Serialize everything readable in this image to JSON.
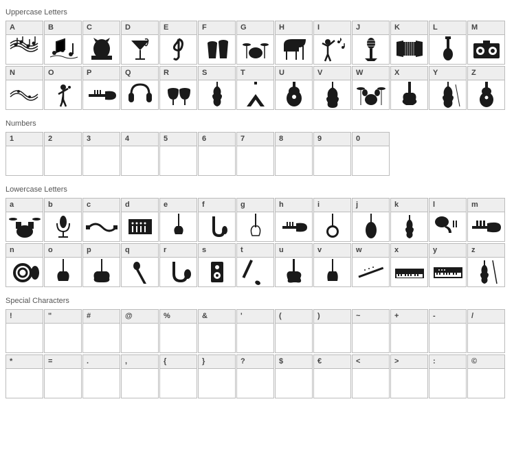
{
  "sections": {
    "uppercase": {
      "title": "Uppercase Letters",
      "cells": [
        {
          "label": "A",
          "glyph": "music-staff-notes",
          "empty": false
        },
        {
          "label": "B",
          "glyph": "music-notes-burst",
          "empty": false
        },
        {
          "label": "C",
          "glyph": "cat-dj",
          "empty": false
        },
        {
          "label": "D",
          "glyph": "cocktail-treble",
          "empty": false
        },
        {
          "label": "E",
          "glyph": "treble-clef",
          "empty": false
        },
        {
          "label": "F",
          "glyph": "conga-drums",
          "empty": false
        },
        {
          "label": "G",
          "glyph": "drum-set-small",
          "empty": false
        },
        {
          "label": "H",
          "glyph": "grand-piano",
          "empty": false
        },
        {
          "label": "I",
          "glyph": "conductor",
          "empty": false
        },
        {
          "label": "J",
          "glyph": "vintage-microphone",
          "empty": false
        },
        {
          "label": "K",
          "glyph": "accordion",
          "empty": false
        },
        {
          "label": "L",
          "glyph": "bass-guitar",
          "empty": false
        },
        {
          "label": "M",
          "glyph": "boombox",
          "empty": false
        },
        {
          "label": "N",
          "glyph": "music-wave",
          "empty": false
        },
        {
          "label": "O",
          "glyph": "singer",
          "empty": false
        },
        {
          "label": "P",
          "glyph": "trumpet",
          "empty": false
        },
        {
          "label": "Q",
          "glyph": "headphones",
          "empty": false
        },
        {
          "label": "R",
          "glyph": "timpani",
          "empty": false
        },
        {
          "label": "S",
          "glyph": "violin",
          "empty": false
        },
        {
          "label": "T",
          "glyph": "flying-v-guitar",
          "empty": false
        },
        {
          "label": "U",
          "glyph": "acoustic-guitar",
          "empty": false
        },
        {
          "label": "V",
          "glyph": "double-bass",
          "empty": false
        },
        {
          "label": "W",
          "glyph": "drum-kit",
          "empty": false
        },
        {
          "label": "X",
          "glyph": "electric-guitar",
          "empty": false
        },
        {
          "label": "Y",
          "glyph": "cello",
          "empty": false
        },
        {
          "label": "Z",
          "glyph": "classical-guitar",
          "empty": false
        }
      ]
    },
    "numbers": {
      "title": "Numbers",
      "cells": [
        {
          "label": "1",
          "glyph": "",
          "empty": true
        },
        {
          "label": "2",
          "glyph": "",
          "empty": true
        },
        {
          "label": "3",
          "glyph": "",
          "empty": true
        },
        {
          "label": "4",
          "glyph": "",
          "empty": true
        },
        {
          "label": "5",
          "glyph": "",
          "empty": true
        },
        {
          "label": "6",
          "glyph": "",
          "empty": true
        },
        {
          "label": "7",
          "glyph": "",
          "empty": true
        },
        {
          "label": "8",
          "glyph": "",
          "empty": true
        },
        {
          "label": "9",
          "glyph": "",
          "empty": true
        },
        {
          "label": "0",
          "glyph": "",
          "empty": true
        }
      ]
    },
    "lowercase": {
      "title": "Lowercase Letters",
      "cells": [
        {
          "label": "a",
          "glyph": "drumset-big",
          "empty": false
        },
        {
          "label": "b",
          "glyph": "studio-mic",
          "empty": false
        },
        {
          "label": "c",
          "glyph": "audio-cable",
          "empty": false
        },
        {
          "label": "d",
          "glyph": "mixing-board",
          "empty": false
        },
        {
          "label": "e",
          "glyph": "electric-guitar-thin",
          "empty": false
        },
        {
          "label": "f",
          "glyph": "saxophone",
          "empty": false
        },
        {
          "label": "g",
          "glyph": "bass-outline",
          "empty": false
        },
        {
          "label": "h",
          "glyph": "trumpet-small",
          "empty": false
        },
        {
          "label": "i",
          "glyph": "banjo",
          "empty": false
        },
        {
          "label": "j",
          "glyph": "mandolin",
          "empty": false
        },
        {
          "label": "k",
          "glyph": "violin-small",
          "empty": false
        },
        {
          "label": "l",
          "glyph": "tuba",
          "empty": false
        },
        {
          "label": "m",
          "glyph": "trumpet-valve",
          "empty": false
        },
        {
          "label": "n",
          "glyph": "french-horn",
          "empty": false
        },
        {
          "label": "o",
          "glyph": "bass-guitar-2",
          "empty": false
        },
        {
          "label": "p",
          "glyph": "electric-guitar-2",
          "empty": false
        },
        {
          "label": "q",
          "glyph": "microphone",
          "empty": false
        },
        {
          "label": "r",
          "glyph": "sax-alto",
          "empty": false
        },
        {
          "label": "s",
          "glyph": "speaker",
          "empty": false
        },
        {
          "label": "t",
          "glyph": "clarinet",
          "empty": false
        },
        {
          "label": "u",
          "glyph": "strat-guitar",
          "empty": false
        },
        {
          "label": "v",
          "glyph": "tele-guitar",
          "empty": false
        },
        {
          "label": "w",
          "glyph": "flute",
          "empty": false
        },
        {
          "label": "x",
          "glyph": "keyboard",
          "empty": false
        },
        {
          "label": "y",
          "glyph": "synth",
          "empty": false
        },
        {
          "label": "z",
          "glyph": "violin-bow",
          "empty": false
        }
      ]
    },
    "special": {
      "title": "Special Characters",
      "cells": [
        {
          "label": "!",
          "glyph": "",
          "empty": true
        },
        {
          "label": "\"",
          "glyph": "",
          "empty": true
        },
        {
          "label": "#",
          "glyph": "",
          "empty": true
        },
        {
          "label": "@",
          "glyph": "",
          "empty": true
        },
        {
          "label": "%",
          "glyph": "",
          "empty": true
        },
        {
          "label": "&",
          "glyph": "",
          "empty": true
        },
        {
          "label": "'",
          "glyph": "",
          "empty": true
        },
        {
          "label": "(",
          "glyph": "",
          "empty": true
        },
        {
          "label": ")",
          "glyph": "",
          "empty": true
        },
        {
          "label": "~",
          "glyph": "",
          "empty": true
        },
        {
          "label": "+",
          "glyph": "",
          "empty": true
        },
        {
          "label": "-",
          "glyph": "",
          "empty": true
        },
        {
          "label": "/",
          "glyph": "",
          "empty": true
        },
        {
          "label": "*",
          "glyph": "",
          "empty": true
        },
        {
          "label": "=",
          "glyph": "",
          "empty": true
        },
        {
          "label": ".",
          "glyph": "",
          "empty": true
        },
        {
          "label": ",",
          "glyph": "",
          "empty": true
        },
        {
          "label": "{",
          "glyph": "",
          "empty": true
        },
        {
          "label": "}",
          "glyph": "",
          "empty": true
        },
        {
          "label": "?",
          "glyph": "",
          "empty": true
        },
        {
          "label": "$",
          "glyph": "",
          "empty": true
        },
        {
          "label": "€",
          "glyph": "",
          "empty": true
        },
        {
          "label": "<",
          "glyph": "",
          "empty": true
        },
        {
          "label": ">",
          "glyph": "",
          "empty": true
        },
        {
          "label": ":",
          "glyph": "",
          "empty": true
        },
        {
          "label": "©",
          "glyph": "",
          "empty": true
        }
      ]
    }
  },
  "glyph_colors": {
    "fill": "#1a1a1a"
  }
}
